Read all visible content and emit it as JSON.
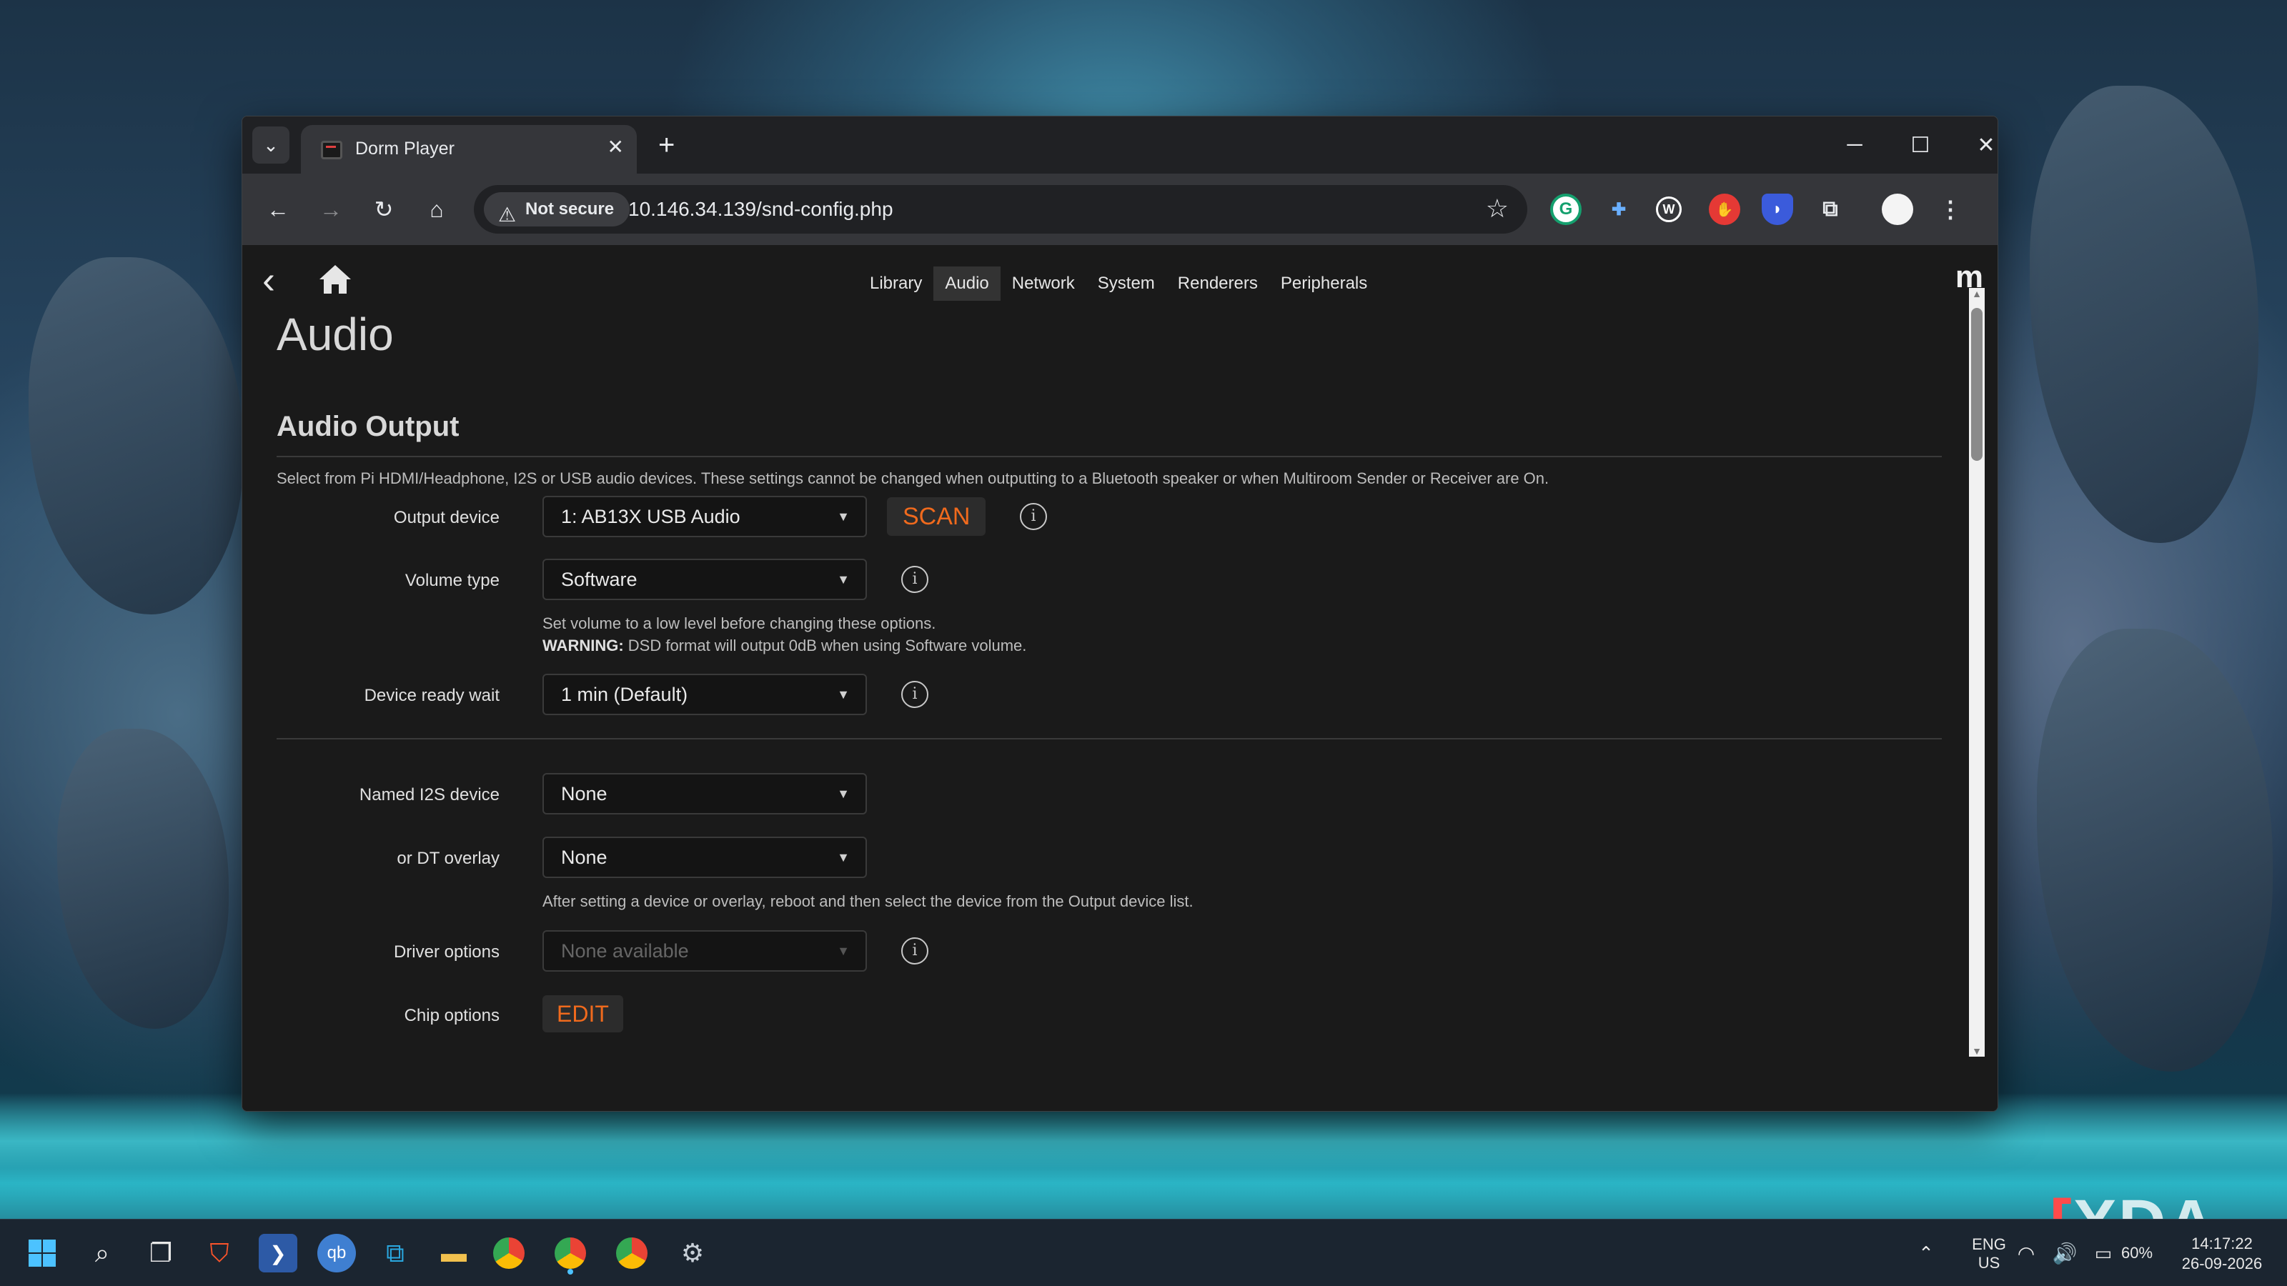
{
  "browser": {
    "tab_title": "Dorm Player",
    "not_secure_label": "Not secure",
    "url": "10.146.34.139/snd-config.php"
  },
  "nav": {
    "tabs": [
      "Library",
      "Audio",
      "Network",
      "System",
      "Renderers",
      "Peripherals"
    ],
    "active_tab": "Audio",
    "logo": "m"
  },
  "page": {
    "title": "Audio",
    "section_title": "Audio Output",
    "section_desc": "Select from Pi HDMI/Headphone, I2S or USB audio devices. These settings cannot be changed when outputting to a Bluetooth speaker or when Multiroom Sender or Receiver are On."
  },
  "fields": {
    "output_device": {
      "label": "Output device",
      "value": "1: AB13X USB Audio",
      "button": "SCAN"
    },
    "volume_type": {
      "label": "Volume type",
      "value": "Software",
      "help_line1": "Set volume to a low level before changing these options.",
      "warning_label": "WARNING:",
      "warning_text": " DSD format will output 0dB when using Software volume."
    },
    "device_ready_wait": {
      "label": "Device ready wait",
      "value": "1 min (Default)"
    },
    "named_i2s": {
      "label": "Named I2S device",
      "value": "None"
    },
    "dt_overlay": {
      "label": "or DT overlay",
      "value": "None",
      "help": "After setting a device or overlay, reboot and then select the device from the Output device list."
    },
    "driver_options": {
      "label": "Driver options",
      "value": "None available"
    },
    "chip_options": {
      "label": "Chip options",
      "button": "EDIT"
    }
  },
  "taskbar": {
    "lang_line1": "ENG",
    "lang_line2": "US",
    "battery": "60%",
    "time": "14:17:22",
    "date": "26-09-2026"
  },
  "watermark": "XDA",
  "colors": {
    "accent_orange": "#f06a1d",
    "page_bg": "#1a1a1a",
    "chrome_bg": "#202124"
  }
}
